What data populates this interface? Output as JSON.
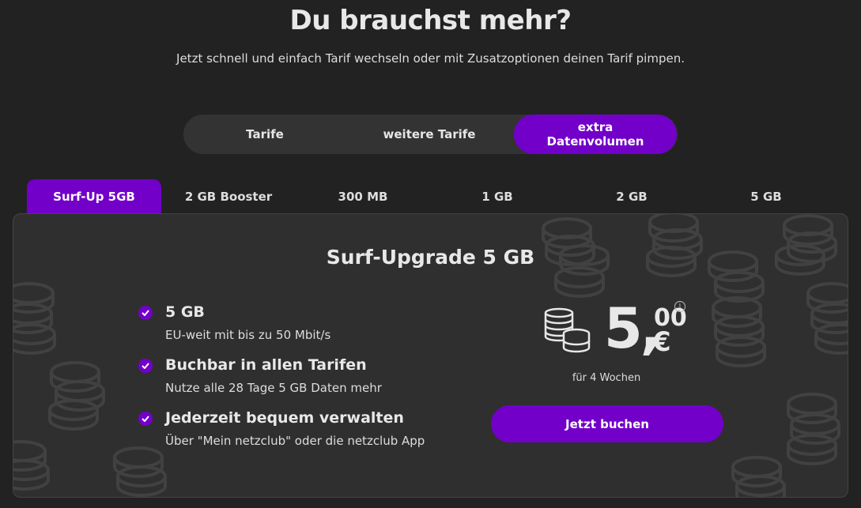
{
  "header": {
    "title": "Du brauchst mehr?",
    "subtitle": "Jetzt schnell und einfach Tarif wechseln oder mit Zusatzoptionen deinen Tarif pimpen."
  },
  "switcher": {
    "items": [
      "Tarife",
      "weitere Tarife",
      "extra\nDatenvolumen"
    ],
    "active": "extra\nDatenvolumen"
  },
  "tabs": {
    "items": [
      "Surf-Up 5GB",
      "2 GB Booster",
      "300 MB",
      "1 GB",
      "2 GB",
      "5 GB"
    ],
    "active": "Surf-Up 5GB"
  },
  "card": {
    "title": "Surf-Upgrade 5 GB",
    "features": [
      {
        "title": "5 GB",
        "subtitle": "EU-weit mit bis zu 50 Mbit/s"
      },
      {
        "title": "Buchbar in allen Tarifen",
        "subtitle": "Nutze alle 28 Tage 5 GB Daten mehr"
      },
      {
        "title": "Jederzeit bequem verwalten",
        "subtitle": "Über \"Mein netzclub\" oder die netzclub App"
      }
    ],
    "price": {
      "main": "5,",
      "cents": "00",
      "currency": "€",
      "info_icon": "i",
      "period": "für 4 Wochen"
    },
    "cta_label": "Jetzt buchen"
  },
  "icons": {
    "check": "check-icon",
    "coins": "coins-icon",
    "info": "info-icon"
  },
  "colors": {
    "accent": "#7200c9",
    "background": "#222222",
    "card": "#2f2f2f",
    "switcher": "#333333"
  }
}
